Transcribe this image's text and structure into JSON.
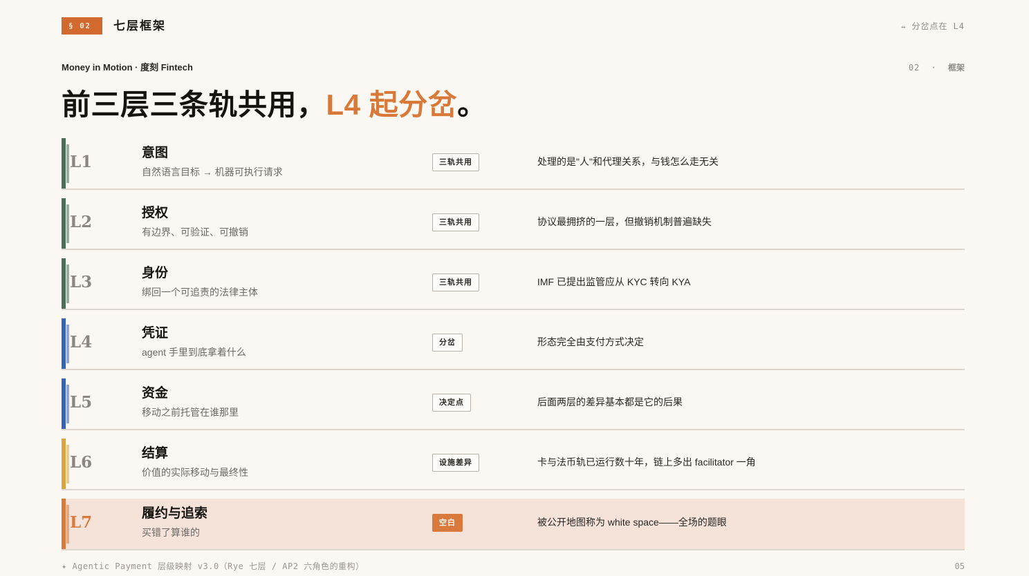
{
  "header": {
    "section_badge": "§ 02",
    "section_title": "七层框架",
    "nav_arrow": "↔",
    "nav_text": "分岔点在 L4"
  },
  "kicker": "Money in Motion · 度刻 Fintech",
  "page_ref": {
    "number": "02",
    "separator": "·",
    "label": "框架"
  },
  "headline": {
    "part1": "前三层三条轨共用，",
    "accent": "L4 起分岔",
    "part2": "。"
  },
  "layers": [
    {
      "id": "L1",
      "name": "意图",
      "desc": "自然语言目标 → 机器可执行请求",
      "tag": "三轨共用",
      "note": "处理的是\"人\"和代理关系，与钱怎么走无关",
      "color": "#4a6e57"
    },
    {
      "id": "L2",
      "name": "授权",
      "desc": "有边界、可验证、可撤销",
      "tag": "三轨共用",
      "note": "协议最拥挤的一层，但撤销机制普遍缺失",
      "color": "#4a6e57"
    },
    {
      "id": "L3",
      "name": "身份",
      "desc": "绑回一个可追责的法律主体",
      "tag": "三轨共用",
      "note": "IMF 已提出监管应从 KYC 转向 KYA",
      "color": "#4a6e57"
    },
    {
      "id": "L4",
      "name": "凭证",
      "desc": "agent 手里到底拿着什么",
      "tag": "分岔",
      "note": "形态完全由支付方式决定",
      "color": "#3563b8"
    },
    {
      "id": "L5",
      "name": "资金",
      "desc": "移动之前托管在谁那里",
      "tag": "决定点",
      "note": "后面两层的差异基本都是它的后果",
      "color": "#3563b8"
    },
    {
      "id": "L6",
      "name": "结算",
      "desc": "价值的实际移动与最终性",
      "tag": "设施差异",
      "note": "卡与法币轨已运行数十年，链上多出 facilitator 一角",
      "color": "#d9a441"
    },
    {
      "id": "L7",
      "name": "履约与追索",
      "desc": "买错了算谁的",
      "tag": "空白",
      "note": "被公开地图称为 white space——全场的题眼",
      "color": "#d9793c"
    }
  ],
  "footer": {
    "note": "✦ Agentic Payment 层级映射 v3.0（Rye 七层 / AP2 六角色的重构）",
    "page_number": "05"
  },
  "colors": {
    "accent": "#d9793c",
    "background": "#fbf8f3",
    "highlight_row": "#f5e3da"
  }
}
